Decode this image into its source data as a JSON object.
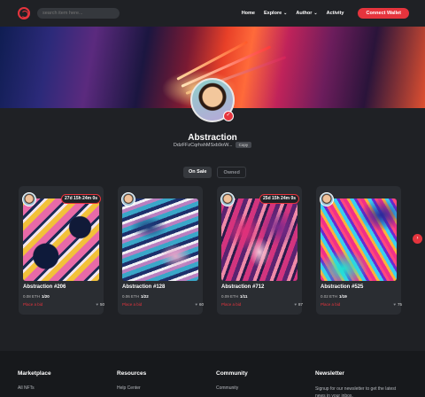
{
  "header": {
    "search_placeholder": "search item here...",
    "nav": [
      {
        "label": "Home",
        "has_dropdown": false
      },
      {
        "label": "Explore",
        "has_dropdown": true
      },
      {
        "label": "Author",
        "has_dropdown": true
      },
      {
        "label": "Activity",
        "has_dropdown": false
      }
    ],
    "connect_label": "Connect Wallet"
  },
  "profile": {
    "name": "Abstraction",
    "wallet": "DdzFFzCqrhshMSxb9oW...",
    "copy_label": "Copy"
  },
  "tabs": [
    {
      "label": "On Sale",
      "active": true
    },
    {
      "label": "Owned",
      "active": false
    }
  ],
  "cards": [
    {
      "title": "Abstraction #206",
      "price_label": "0.08 ETH",
      "edition": "1/20",
      "bid_label": "Place a bid",
      "likes": "50",
      "timer": "27d 15h 24m 0s"
    },
    {
      "title": "Abstraction #128",
      "price_label": "0.06 ETH",
      "edition": "1/22",
      "bid_label": "Place a bid",
      "likes": "60",
      "timer": ""
    },
    {
      "title": "Abstraction #712",
      "price_label": "0.09 ETH",
      "edition": "1/11",
      "bid_label": "Place a bid",
      "likes": "87",
      "timer": "25d 15h 24m 0s"
    },
    {
      "title": "Abstraction #525",
      "price_label": "0.02 ETH",
      "edition": "1/19",
      "bid_label": "Place a bid",
      "likes": "75",
      "timer": ""
    }
  ],
  "footer": {
    "marketplace": {
      "heading": "Marketplace",
      "link": "All NFTs"
    },
    "resources": {
      "heading": "Resources",
      "link": "Help Center"
    },
    "community": {
      "heading": "Community",
      "link": "Community"
    },
    "newsletter": {
      "heading": "Newsletter",
      "text": "Signup for our newsletter to get the latest news in your inbox."
    }
  },
  "colors": {
    "accent": "#e5343d",
    "background": "#1f2125",
    "card": "#2a2d32"
  }
}
